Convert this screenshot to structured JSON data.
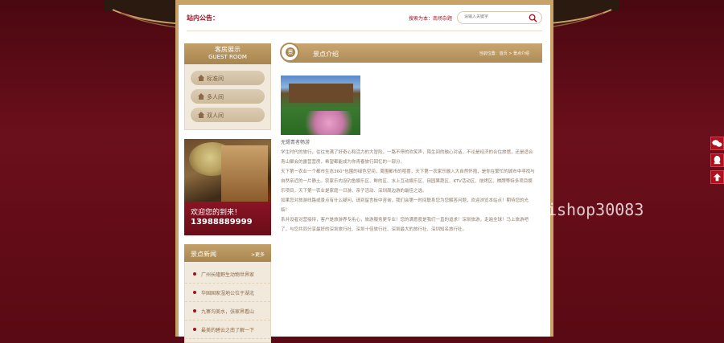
{
  "header": {
    "notice_label": "站内公告：",
    "search_hint": "搜索为本：南场杂题",
    "search_placeholder": "请输入关键字"
  },
  "sidebar": {
    "room_panel": {
      "title_cn": "客房展示",
      "title_en": "GUEST ROOM"
    },
    "rooms": [
      {
        "label": "标准间"
      },
      {
        "label": "多人间"
      },
      {
        "label": "双人间"
      }
    ],
    "banner": {
      "welcome": "欢迎您的到来！",
      "phone": "13988889999"
    },
    "news": {
      "title": "景点新闻",
      "more": ">更多",
      "items": [
        {
          "text": "广州长隆野生动物世界家"
        },
        {
          "text": "华国国家湿地公位于湖北"
        },
        {
          "text": "九寨沟美水，张家界看山"
        },
        {
          "text": "最美的碧云之南了解一下"
        }
      ]
    }
  },
  "main": {
    "section_icon": "景",
    "title": "景点介绍",
    "breadcrumb": "当前位置：首页 > 景点介绍",
    "photo_caption": "无锡青者畅游",
    "paragraphs": [
      "学生时代的旅行，往往充满了好奇心和活力的大冒险，一路不停的欢笑声，陌生间的融心对话，不论是经济的合住旅馆，还是适合青山聚会的露营营房，希望都能成为你青春旅行回忆的一部分。",
      "天下第一农业一个都市生态360°包围的绿色空间，周围都市的喧嚣，天下第一农家乐融入大自然怀抱，是你在繁忙的城市中寻找与自然亲近的一片静土。农家乐内设钓鱼娱乐区、鲜的区、水上互动娱乐区、田园果蔬区、KTV活动区、烧烤区、棋牌等特多项目娱乐项目，天下第一农业是家庭一日游、亲子活动、深圳周边游的最佳之选。",
      "如果您对旅游线路或景点有什么疑问，请到留言板中咨询，我们会第一时间联系您为您解答问题，欢迎浏览本站点！期待您的光临！",
      "系并设者对营接待，客户是旅游界专用心，旅游服务更专业！您的满意度是我们一直的追求！深圳旅游，走遍全球！马上旅游吧了，与您共同分享最好的深圳旅行社、深圳十佳旅行社、深圳最大的旅行社、深圳知名旅行社。"
    ]
  },
  "floating": [
    {
      "name": "wechat-icon"
    },
    {
      "name": "qq-icon"
    },
    {
      "name": "back-to-top-icon"
    }
  ],
  "watermark": "https://www.huzhan.com/ishop30083",
  "colors": {
    "brand_red": "#a01020",
    "gold": "#ae8c58",
    "bg_maroon": "#5a0a14"
  }
}
